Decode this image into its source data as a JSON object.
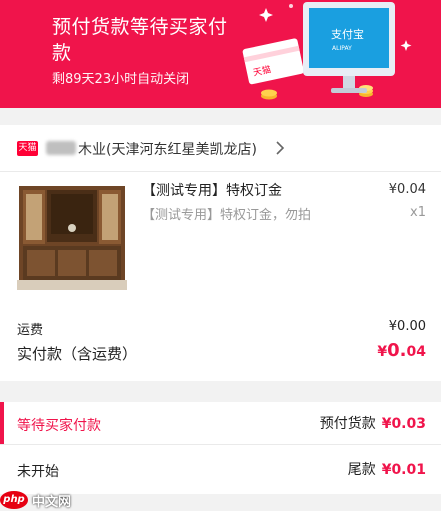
{
  "banner": {
    "title": "预付货款等待买家付款",
    "countdown": "剩89天23小时自动关闭",
    "illustration": {
      "card_label": "天猫",
      "screen_brand": "支付宝",
      "screen_sub": "ALIPAY"
    }
  },
  "store": {
    "badge": "天猫",
    "name": "木业(天津河东红星美凯龙店)"
  },
  "product": {
    "title": "【测试专用】特权订金",
    "subtitle": "【测试专用】特权订金，勿拍",
    "price": "¥0.04",
    "qty": "x1"
  },
  "summary": {
    "freight_label": "运费",
    "freight_value": "¥0.00",
    "paid_label": "实付款（含运费）",
    "paid_currency": "¥",
    "paid_int": "0.",
    "paid_dec": "04"
  },
  "stages": [
    {
      "status": "等待买家付款",
      "label": "预付货款",
      "amount": "¥0.03",
      "active": true
    },
    {
      "status": "未开始",
      "label": "尾款",
      "amount": "¥0.01",
      "active": false
    }
  ],
  "watermark": {
    "badge": "php",
    "text": "中文网"
  },
  "colors": {
    "brand": "#f0144b",
    "tmall": "#ff0036"
  }
}
